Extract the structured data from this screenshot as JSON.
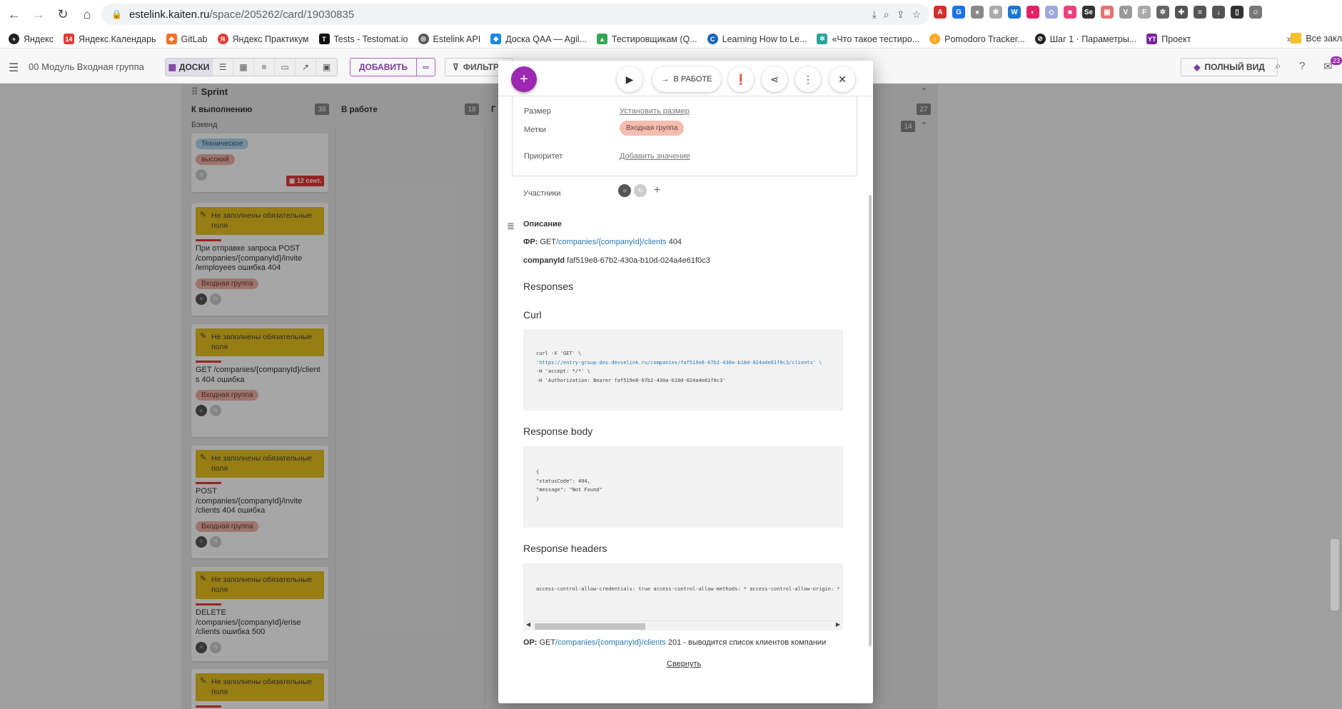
{
  "browser": {
    "url_host": "estelink.kaiten.ru",
    "url_path": "/space/205262/card/19030835",
    "bookmarks": [
      "Яндекс",
      "Яндекс.Календарь",
      "GitLab",
      "Яндекс Практикум",
      "Tests - Testomat.io",
      "Estelink API",
      "Доска QAA — Agil...",
      "Тестировщикам (Q...",
      "Learning How to Le...",
      "«Что такое тестиро...",
      "Pomodoro Tracker...",
      "Шаг 1 · Параметры...",
      "Проект"
    ],
    "bookmarks_more": "»",
    "bookmarks_last": "Все закл"
  },
  "app": {
    "space_title": "00 Модуль Входная группа",
    "view_boards": "ДОСКИ",
    "add_label": "ДОБАВИТЬ",
    "filter_label": "ФИЛЬТР",
    "full_view_label": "ПОЛНЫЙ ВИД",
    "notifications_count": "23"
  },
  "board": {
    "sprint": "Sprint",
    "columns": [
      {
        "title": "К выполнению",
        "count": "38"
      },
      {
        "title": "В работе",
        "count": "18"
      },
      {
        "title": "Г",
        "count": ""
      },
      {
        "title": "",
        "count": "27"
      }
    ],
    "lane": "Бэкенд",
    "lane_count": "14",
    "cards": [
      {
        "tags": [
          "Техническое",
          "высокий"
        ],
        "date": "12 сент."
      },
      {
        "warning": "Не заполнены обязательные поля",
        "title": "При отправке запроса POST /companies/{companyId}/invite /employees ошибка 404",
        "tag": "Входная группа"
      },
      {
        "warning": "Не заполнены обязательные поля",
        "title": "GET /companies/{companyId}/client s 404 ошибка",
        "tag": "Входная группа"
      },
      {
        "warning": "Не заполнены обязательные поля",
        "title": "POST /companies/{companyId}/invite /clients 404 ошибка",
        "tag": "Входная группа"
      },
      {
        "warning": "Не заполнены обязательные поля",
        "title": "DELETE /companies/{companyId}/erise /clients ошибка 500"
      },
      {
        "warning": "Не заполнены обязательные поля"
      }
    ]
  },
  "modal": {
    "status_label": "В РАБОТЕ",
    "props": {
      "size_label": "Размер",
      "size_value": "Установить размер",
      "tags_label": "Метки",
      "tags_value": "Входная группа",
      "priority_label": "Приоритет",
      "priority_value": "Добавить значение"
    },
    "members_label": "Участники",
    "description": {
      "title": "Описание",
      "fr_label": "ФР:",
      "fr_method": "GET",
      "fr_path": "/companies/{companyId}/clients",
      "fr_code": " 404",
      "company_label": "companyId",
      "company_value": " faf519e8-67b2-430a-b10d-024a4e61f0c3",
      "responses": "Responses",
      "curl": "Curl",
      "curl_lines": [
        "curl -X 'GET' \\",
        "  'https://entry-group-dev.devselink.ru/companies/faf519e8-67b2-430a-b10d-024a4e61f0c3/clients' \\",
        "  -H 'accept: */*' \\",
        "  -H 'Authorization: Bearer faf519e8-67b2-430a-b10d-024a4e61f0c3'"
      ],
      "response_body": "Response body",
      "body_lines": [
        "{",
        "  \"statusCode\": 404,",
        "  \"message\": \"Not Found\"",
        "}"
      ],
      "response_headers": "Response headers",
      "headers_line": " access-control-allow-credentials: true  access-control-allow-methods: *  access-control-allow-origin: *  connection: ke",
      "or_label": "ОР:",
      "or_method": "GET",
      "or_path": "/companies/{companyId}/clients",
      "or_text": " 201 - выводится список клиентов компании",
      "collapse": "Свернуть"
    }
  },
  "colors": {
    "accent": "#9c27b0",
    "warning": "#e6c01f",
    "tag": "#f1b3a8",
    "link": "#2879b8"
  }
}
